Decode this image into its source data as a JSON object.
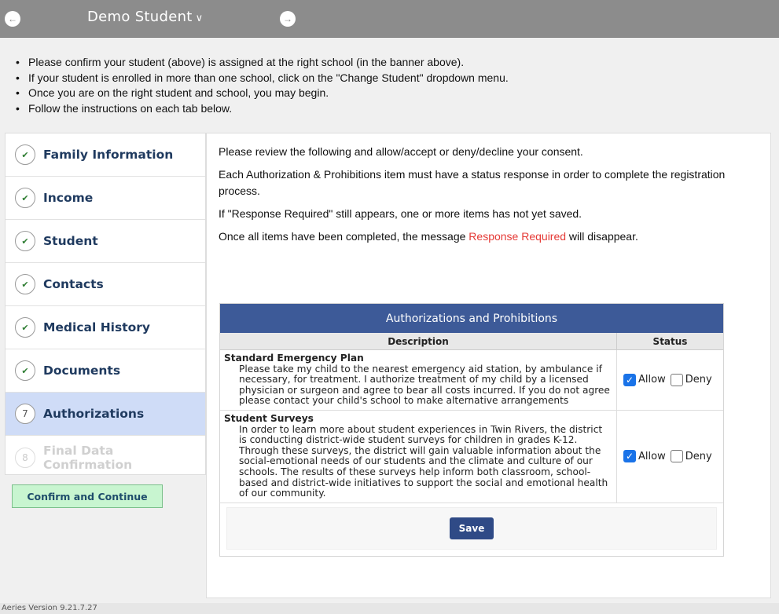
{
  "header": {
    "title": "Demo Student",
    "prev_icon": "arrow-left-circle-icon",
    "next_icon": "arrow-right-circle-icon",
    "prev_glyph": "←",
    "next_glyph": "→",
    "chevron": "∨"
  },
  "instructions": [
    "Please confirm your student (above) is assigned at the right school (in the banner above).",
    "If your student is enrolled in more than one school, click on the \"Change Student\" dropdown menu.",
    "Once you are on the right student and school, you may begin.",
    "Follow the instructions on each tab below."
  ],
  "sidebar": {
    "items": [
      {
        "label": "Family Information",
        "marker": "✔",
        "state": "complete"
      },
      {
        "label": "Income",
        "marker": "✔",
        "state": "complete"
      },
      {
        "label": "Student",
        "marker": "✔",
        "state": "complete"
      },
      {
        "label": "Contacts",
        "marker": "✔",
        "state": "complete"
      },
      {
        "label": "Medical History",
        "marker": "✔",
        "state": "complete"
      },
      {
        "label": "Documents",
        "marker": "✔",
        "state": "complete"
      },
      {
        "label": "Authorizations",
        "marker": "7",
        "state": "active"
      },
      {
        "label": "Final Data Confirmation",
        "marker": "8",
        "state": "disabled"
      }
    ],
    "confirm_label": "Confirm and Continue"
  },
  "main": {
    "intro": [
      "Please review the following and allow/accept or deny/decline your consent.",
      "Each Authorization & Prohibitions item must have a status response in order to complete the registration process.",
      "If \"Response Required\" still appears, one or more items has not yet saved."
    ],
    "final_line_prefix": "Once all items have been completed, the message ",
    "final_line_highlight": "Response Required",
    "final_line_suffix": " will disappear.",
    "highlight_color": "#e53935"
  },
  "auth_table": {
    "title": "Authorizations and Prohibitions",
    "columns": {
      "description": "Description",
      "status": "Status"
    },
    "allow_label": "Allow",
    "deny_label": "Deny",
    "rows": [
      {
        "title": "Standard Emergency Plan",
        "text": "Please take my child to the nearest emergency aid station, by ambulance if necessary, for treatment. I authorize treatment of my child by a licensed physician or surgeon and agree to bear all costs incurred. If you do not agree please contact your child's school to make alternative arrangements",
        "allow": true,
        "deny": false
      },
      {
        "title": "Student Surveys",
        "text": "In order to learn more about student experiences in Twin Rivers, the district is conducting district-wide student surveys for children in grades K-12. Through these surveys, the district will gain valuable information about the social-emotional needs of our students and the climate and culture of our schools. The results of these surveys help inform both classroom, school-based and district-wide initiatives to support the social and emotional health of our community.",
        "allow": true,
        "deny": false
      }
    ],
    "save_label": "Save"
  },
  "footer": {
    "version": "Aeries Version 9.21.7.27"
  },
  "colors": {
    "header_bg": "#8c8c8c",
    "table_title_bg": "#3d5a98",
    "active_tab_bg": "#cfdcf7",
    "confirm_bg": "#c8f5d0"
  }
}
